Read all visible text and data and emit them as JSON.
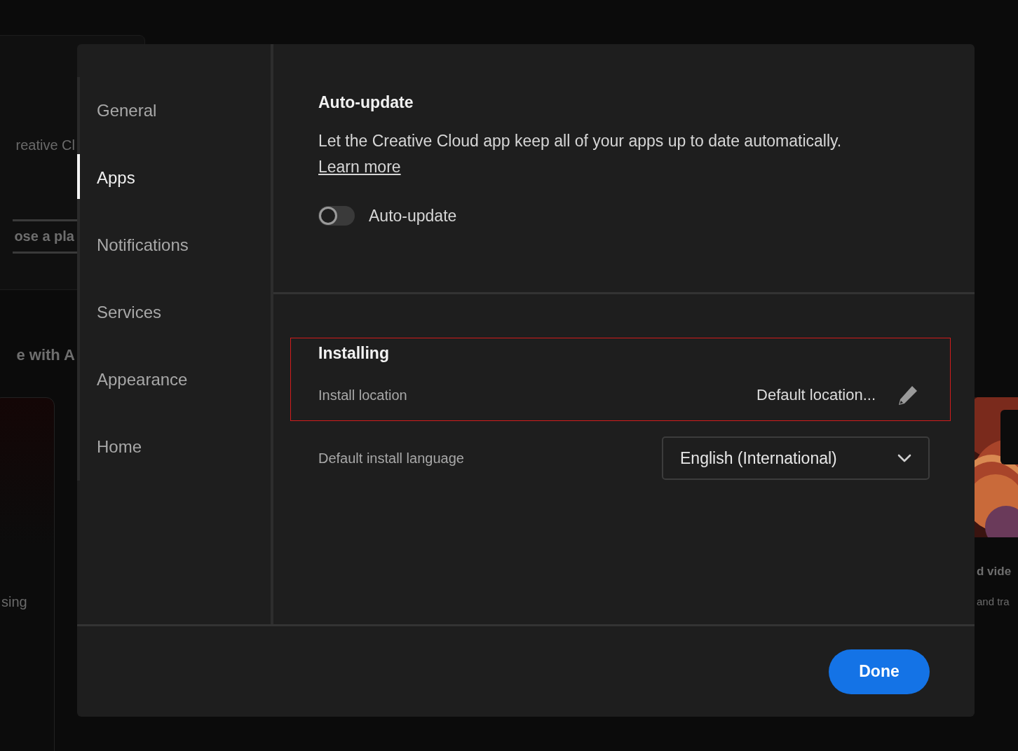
{
  "background": {
    "fragments": [
      {
        "kind": "text",
        "text": "reative Cl"
      },
      {
        "kind": "button",
        "text": "ose a pla"
      },
      {
        "kind": "heading",
        "text": "e with A"
      },
      {
        "kind": "text",
        "text": "sing"
      }
    ],
    "right_fragments": [
      {
        "kind": "heading",
        "text": "d vide"
      },
      {
        "kind": "text",
        "text": "and tra"
      }
    ]
  },
  "dialog": {
    "sidebar": {
      "items": [
        {
          "label": "General",
          "selected": false
        },
        {
          "label": "Apps",
          "selected": true
        },
        {
          "label": "Notifications",
          "selected": false
        },
        {
          "label": "Services",
          "selected": false
        },
        {
          "label": "Appearance",
          "selected": false
        },
        {
          "label": "Home",
          "selected": false
        }
      ]
    },
    "auto_update": {
      "title": "Auto-update",
      "description": "Let the Creative Cloud app keep all of your apps up to date automatically.",
      "link": "Learn more",
      "toggle": {
        "label": "Auto-update",
        "on": false
      }
    },
    "installing": {
      "title": "Installing",
      "highlighted": true,
      "location_label": "Install location",
      "location_value": "Default location...",
      "language_label": "Default install language",
      "language_value": "English (International)"
    },
    "buttons": [
      "Done"
    ]
  }
}
